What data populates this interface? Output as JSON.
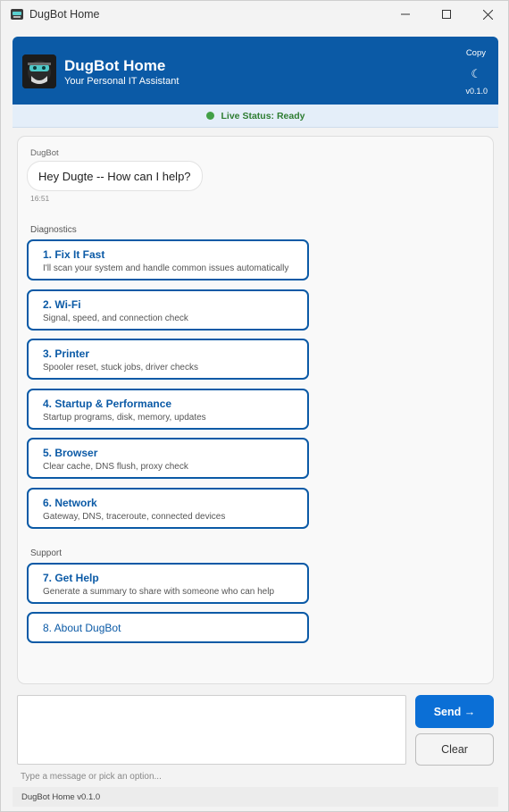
{
  "window": {
    "title": "DugBot Home"
  },
  "header": {
    "app_name": "DugBot Home",
    "subtitle": "Your Personal IT Assistant",
    "copy_label": "Copy",
    "theme_glyph": "☾",
    "version": "v0.1.0",
    "brand_color": "#0b5aa6"
  },
  "status": {
    "text": "Live Status: Ready",
    "indicator_color": "#43a047"
  },
  "chat": {
    "sender": "DugBot",
    "message": "Hey Dugte -- How can I help?",
    "time": "16:51",
    "diagnostics_label": "Diagnostics",
    "support_label": "Support",
    "diagnostics": [
      {
        "title": "1. Fix It Fast",
        "desc": "I'll scan your system and handle common issues automatically"
      },
      {
        "title": "2. Wi-Fi",
        "desc": "Signal, speed, and connection check"
      },
      {
        "title": "3. Printer",
        "desc": "Spooler reset, stuck jobs, driver checks"
      },
      {
        "title": "4. Startup & Performance",
        "desc": "Startup programs, disk, memory, updates"
      },
      {
        "title": "5. Browser",
        "desc": "Clear cache, DNS flush, proxy check"
      },
      {
        "title": "6. Network",
        "desc": "Gateway, DNS, traceroute, connected devices"
      }
    ],
    "support": [
      {
        "title": "7. Get Help",
        "desc": "Generate a summary to share with someone who can help"
      },
      {
        "title": "8. About DugBot"
      }
    ]
  },
  "input": {
    "value": "",
    "hint": "Type a message or pick an option...",
    "send_label": "Send →",
    "clear_label": "Clear"
  },
  "footer": {
    "text": "DugBot Home v0.1.0"
  },
  "icons": {
    "app": "robot-icon",
    "minimize": "minimize-icon",
    "maximize": "maximize-icon",
    "close": "close-icon",
    "theme": "moon-icon",
    "status": "status-dot-icon"
  }
}
